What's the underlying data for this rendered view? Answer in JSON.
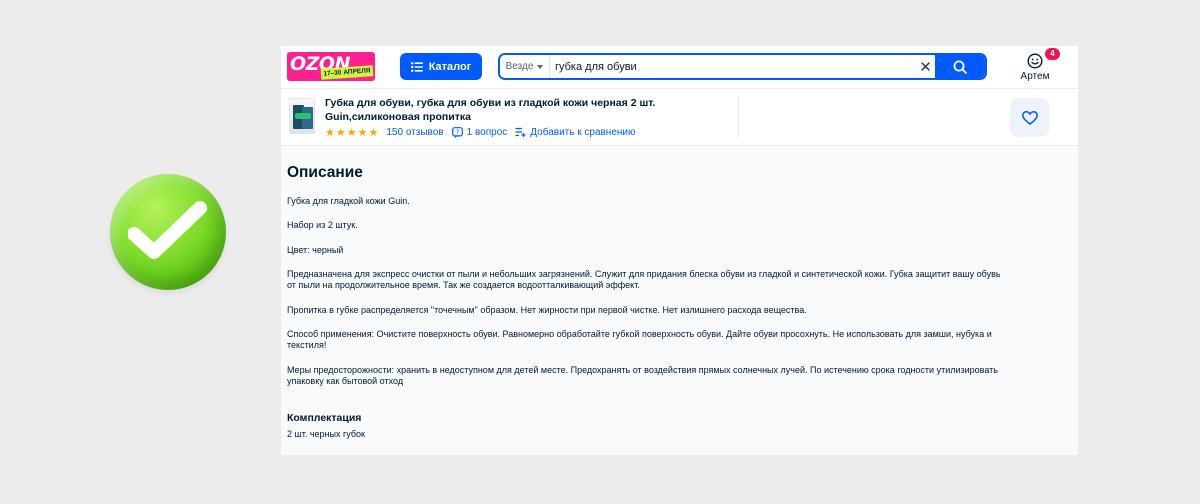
{
  "header": {
    "logo_text": "OZON",
    "logo_promo": "17–30 АПРЕЛЯ",
    "catalog_label": "Каталог",
    "search": {
      "scope": "Везде",
      "value": "губка для обуви",
      "placeholder": ""
    },
    "user": {
      "name": "Артем",
      "badge_count": "4"
    }
  },
  "product": {
    "title": "Губка для обуви, губка для обуви из гладкой кожи черная 2 шт. Guin,силиконовая пропитка",
    "rating_stars": 5,
    "reviews": "150 отзывов",
    "questions": "1 вопрос",
    "compare": "Добавить к сравнению"
  },
  "description": {
    "title": "Описание",
    "paragraphs": [
      "Губка для гладкой кожи Guin.",
      "Набор из 2 штук.",
      "Цвет: черный",
      "Предназначена для экспресс очистки от пыли и небольших загрязнений. Служит для придания блеска обуви из гладкой и синтетической кожи. Губка защитит вашу обувь от пыли на продолжительное время. Так же создается водоотталкивающий эффект.",
      "Пропитка в губке распределяется \"точечным\" образом. Нет жирности при первой чистке. Нет излишнего расхода вещества.",
      "Способ применения: Очистите поверхность обуви. Равномерно обработайте губкой поверхность обуви. Дайте обуви просохнуть. Не использовать для замши, нубука и текстиля!",
      "Меры предосторожности: хранить в недоступном для детей месте. Предохранять от воздействия прямых солнечных лучей. По истечению срока годности утилизировать упаковку как бытовой отход"
    ],
    "kit_title": "Комплектация",
    "kit_text": "2 шт. черных губок"
  },
  "colors": {
    "brand_blue": "#005bff",
    "ozon_pink": "#ff1f8f",
    "star": "#ffa800",
    "badge_red": "#f91155",
    "check_green": "#6cd11f"
  },
  "icons": [
    "check-mark-icon",
    "menu-icon",
    "chevron-down-icon",
    "clear-icon",
    "search-icon",
    "user-smile-icon",
    "question-icon",
    "compare-icon",
    "heart-icon"
  ]
}
